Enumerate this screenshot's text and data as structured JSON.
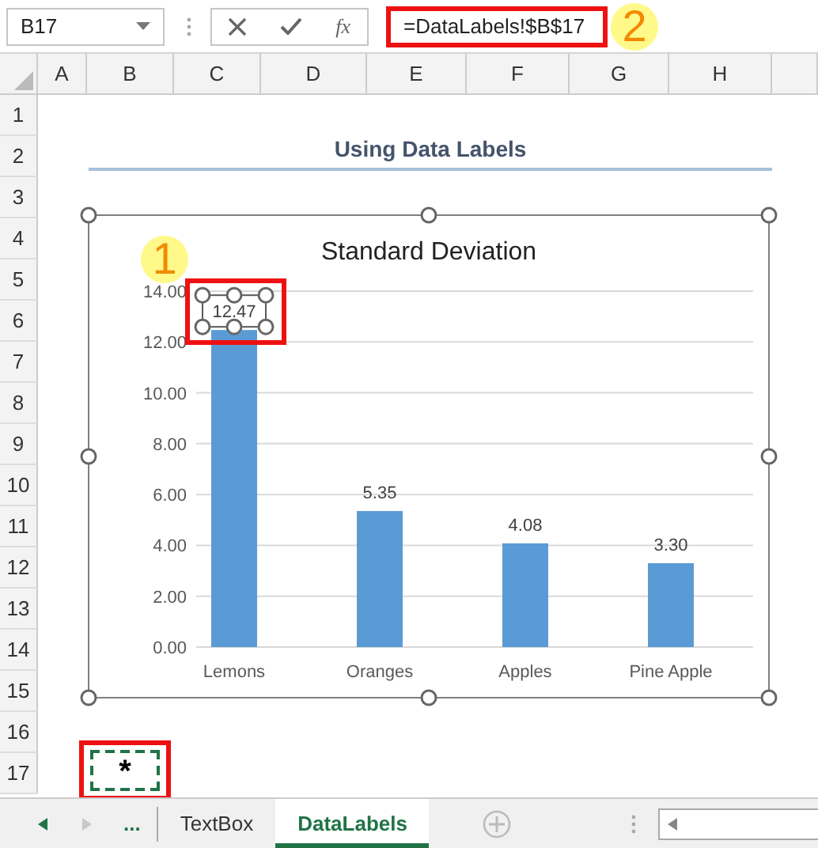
{
  "name_box": {
    "value": "B17"
  },
  "function_label": "fx",
  "formula": {
    "value": "=DataLabels!$B$17"
  },
  "columns": [
    "A",
    "B",
    "C",
    "D",
    "E",
    "F",
    "G",
    "H"
  ],
  "rows": [
    "1",
    "2",
    "3",
    "4",
    "5",
    "6",
    "7",
    "8",
    "9",
    "10",
    "11",
    "12",
    "13",
    "14",
    "15",
    "16",
    "17"
  ],
  "heading_cell": "Using Data Labels",
  "chart": {
    "selected": true,
    "chart_data": {
      "type": "bar",
      "title": "Standard Deviation",
      "categories": [
        "Lemons",
        "Oranges",
        "Apples",
        "Pine Apple"
      ],
      "series": [
        {
          "color": "#5b9bd5",
          "values": [
            12.47,
            5.35,
            4.08,
            3.3
          ]
        }
      ],
      "grid": true,
      "ylim": [
        0,
        14
      ],
      "yticks": [
        {
          "value": 0,
          "label": "0.00"
        },
        {
          "value": 2,
          "label": "2.00"
        },
        {
          "value": 4,
          "label": "4.00"
        },
        {
          "value": 6,
          "label": "6.00"
        },
        {
          "value": 8,
          "label": "8.00"
        },
        {
          "value": 10,
          "label": "10.00"
        },
        {
          "value": 12,
          "label": "12.00"
        },
        {
          "value": 14,
          "label": "14.00"
        }
      ],
      "value_labels": [
        "12.47",
        "5.35",
        "4.08",
        "3.30"
      ]
    },
    "labels": [
      {
        "selected": true
      },
      {
        "selected": false
      },
      {
        "selected": false
      },
      {
        "selected": false
      }
    ]
  },
  "callouts": [
    "1",
    "2"
  ],
  "active_cell": {
    "value": "*"
  },
  "sheet_tabs": [
    {
      "label": "TextBox",
      "selected": false
    },
    {
      "label": "DataLabels",
      "selected": true
    }
  ],
  "tab_overflow": "..."
}
